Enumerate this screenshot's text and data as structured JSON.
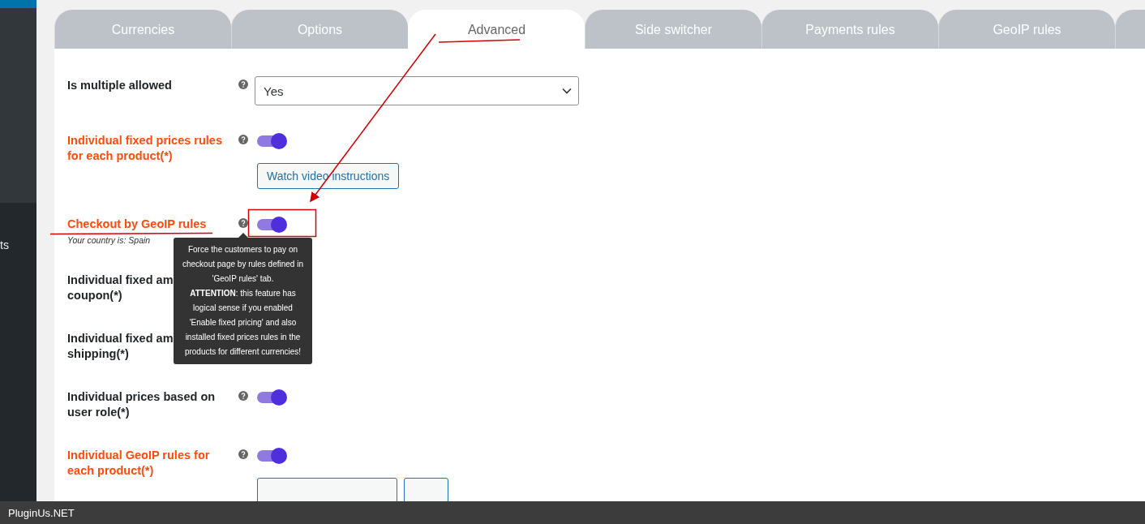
{
  "sidebar": {
    "items": [
      {
        "label": "ts"
      }
    ]
  },
  "tabs": [
    {
      "label": "Currencies",
      "selected": false
    },
    {
      "label": "Options",
      "selected": false
    },
    {
      "label": "Advanced",
      "selected": true
    },
    {
      "label": "Side switcher",
      "selected": false
    },
    {
      "label": "Payments rules",
      "selected": false
    },
    {
      "label": "GeoIP rules",
      "selected": false
    },
    {
      "selected": false
    }
  ],
  "rows": [
    {
      "kind": "select",
      "label_lines": [
        "Is multiple allowed"
      ],
      "highlighted": false,
      "value": "Yes"
    },
    {
      "kind": "toggle",
      "label_lines": [
        "Individual fixed prices rules",
        "for each product(*)"
      ],
      "highlighted": true,
      "on": true,
      "buttons": [
        {
          "kind": "wide",
          "label": "Watch video instructions"
        }
      ]
    },
    {
      "kind": "toggle",
      "label_lines": [
        "Checkout by GeoIP rules"
      ],
      "note": "Your country is: Spain",
      "highlighted": true,
      "on": true
    },
    {
      "kind": "hidden",
      "label_lines": [
        "Individual fixed am",
        "coupon(*)"
      ],
      "highlighted": false
    },
    {
      "kind": "hidden",
      "label_lines": [
        "Individual fixed am",
        "shipping(*)"
      ],
      "highlighted": false
    },
    {
      "kind": "toggle",
      "label_lines": [
        "Individual prices based on",
        "user role(*)"
      ],
      "highlighted": false,
      "on": true
    },
    {
      "kind": "toggle",
      "label_lines": [
        "Individual GeoIP rules for",
        "each product(*)"
      ],
      "highlighted": true,
      "on": true,
      "buttons": [
        {
          "kind": "wide"
        },
        {
          "kind": "narrow"
        }
      ]
    }
  ],
  "tooltip": {
    "paragraphs": [
      "Force the customers to pay on checkout page by rules defined in 'GeoIP rules' tab.",
      "**ATTENTION**: this feature has logical sense if you enabled 'Enable fixed pricing' and also installed fixed prices rules in the products for different currencies!"
    ]
  },
  "footer": {
    "brand": "PluginUs.NET"
  }
}
